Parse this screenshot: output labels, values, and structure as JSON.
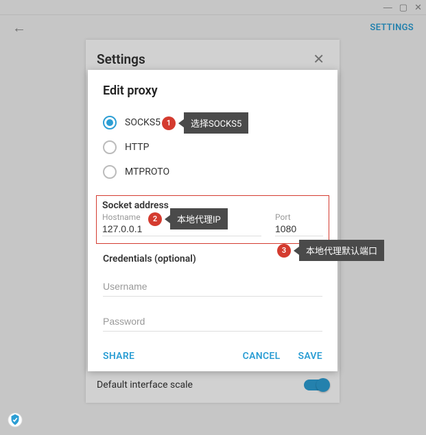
{
  "window": {
    "minimize": "—",
    "maximize": "▢",
    "close": "✕"
  },
  "header": {
    "back": "←",
    "settings_link": "SETTINGS"
  },
  "bg_panel": {
    "title": "Settings",
    "close": "✕",
    "default_scale_label": "Default interface scale"
  },
  "modal": {
    "title": "Edit proxy",
    "radios": {
      "socks5": "SOCKS5",
      "http": "HTTP",
      "mtproto": "MTPROTO"
    },
    "socket_section": "Socket address",
    "hostname_label": "Hostname",
    "hostname_value": "127.0.0.1",
    "port_label": "Port",
    "port_value": "1080",
    "credentials_title": "Credentials (optional)",
    "username_placeholder": "Username",
    "password_placeholder": "Password",
    "share": "SHARE",
    "cancel": "CANCEL",
    "save": "SAVE"
  },
  "callouts": {
    "c1": {
      "num": "1",
      "text": "选择SOCKS5"
    },
    "c2": {
      "num": "2",
      "text": "本地代理IP"
    },
    "c3": {
      "num": "3",
      "text": "本地代理默认端口"
    }
  }
}
